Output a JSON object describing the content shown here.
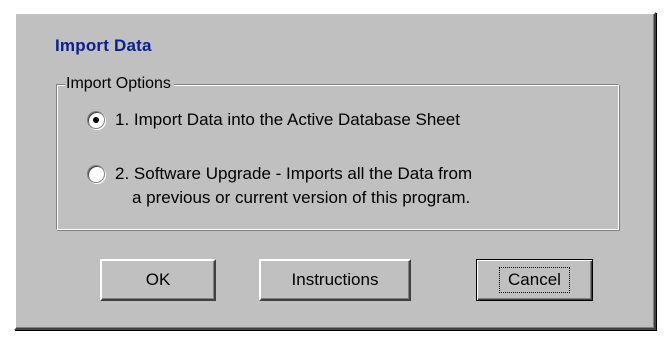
{
  "dialog": {
    "title": "Import Data",
    "group_label": "Import Options",
    "options": [
      {
        "line1": "1. Import Data into the Active Database Sheet",
        "line2": "",
        "selected": true
      },
      {
        "line1": "2. Software Upgrade - Imports all the Data from",
        "line2": "a previous or current version of this program.",
        "selected": false
      }
    ],
    "buttons": {
      "ok": "OK",
      "instructions": "Instructions",
      "cancel": "Cancel"
    }
  }
}
